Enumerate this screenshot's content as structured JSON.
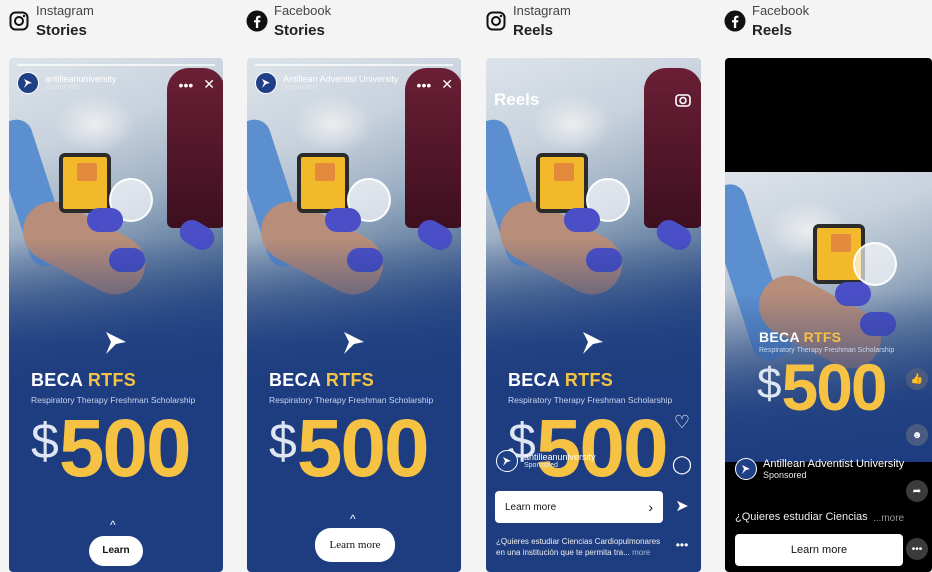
{
  "columns": [
    {
      "platform": "Instagram",
      "placement": "Stories"
    },
    {
      "platform": "Facebook",
      "placement": "Stories"
    },
    {
      "platform": "Instagram",
      "placement": "Reels"
    },
    {
      "platform": "Facebook",
      "placement": "Reels"
    }
  ],
  "ad": {
    "beca": "BECA",
    "rtfs": "RTFS",
    "subtitle": "Respiratory Therapy Freshman Scholarship",
    "dollar": "$",
    "amount": "500",
    "learn_more": "Learn more"
  },
  "ig_story": {
    "account": "antilleanuniversity",
    "sponsored": "Sponsored"
  },
  "fb_story": {
    "account": "Antillean Adventist University",
    "sponsored": "Sponsored"
  },
  "ig_reels": {
    "title": "Reels",
    "account": "antilleanuniversity",
    "sponsored": "Sponsored",
    "caption_line1": "¿Quieres estudiar Ciencias Cardiopulmonares",
    "caption_line2": "en una institución que te permita tra...",
    "more": "more"
  },
  "fb_reels": {
    "account": "Antillean Adventist University",
    "sponsored": "Sponsored",
    "caption": "¿Quieres estudiar Ciencias",
    "more": "...more"
  },
  "colors": {
    "brand_blue": "#1e3d80",
    "gold": "#f5c243"
  }
}
